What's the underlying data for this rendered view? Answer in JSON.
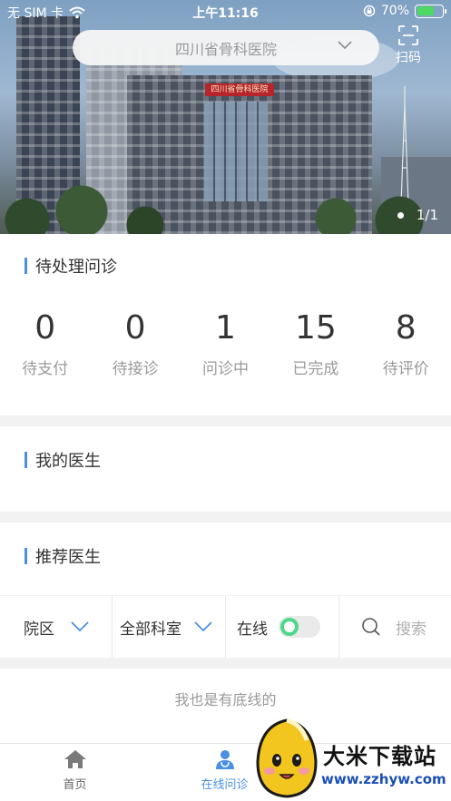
{
  "status_bar": {
    "carrier": "无 SIM 卡",
    "time": "上午11:16",
    "battery": "70%",
    "battery_level": 0.7
  },
  "header": {
    "hospital": "四川省骨科医院",
    "scan_label": "扫码",
    "banner_sign": "四川省骨科医院",
    "pager": "1/1"
  },
  "pending": {
    "title": "待处理问诊",
    "stats": [
      {
        "value": "0",
        "label": "待支付"
      },
      {
        "value": "0",
        "label": "待接诊"
      },
      {
        "value": "1",
        "label": "问诊中"
      },
      {
        "value": "15",
        "label": "已完成"
      },
      {
        "value": "8",
        "label": "待评价"
      }
    ]
  },
  "my_doctors": {
    "title": "我的医生"
  },
  "recommended": {
    "title": "推荐医生"
  },
  "filters": {
    "campus": "院区",
    "department": "全部科室",
    "online": "在线",
    "online_enabled": true,
    "search": "搜索"
  },
  "list_footer": "我也是有底线的",
  "tabbar": {
    "tabs": [
      {
        "label": "首页"
      },
      {
        "label": "在线问诊"
      }
    ]
  },
  "watermark": {
    "name": "大米下载站",
    "url": "www.zzhyw.com"
  },
  "colors": {
    "accent": "#4a90e2",
    "toggle_on": "#4cd98a",
    "battery": "#4cd964"
  }
}
